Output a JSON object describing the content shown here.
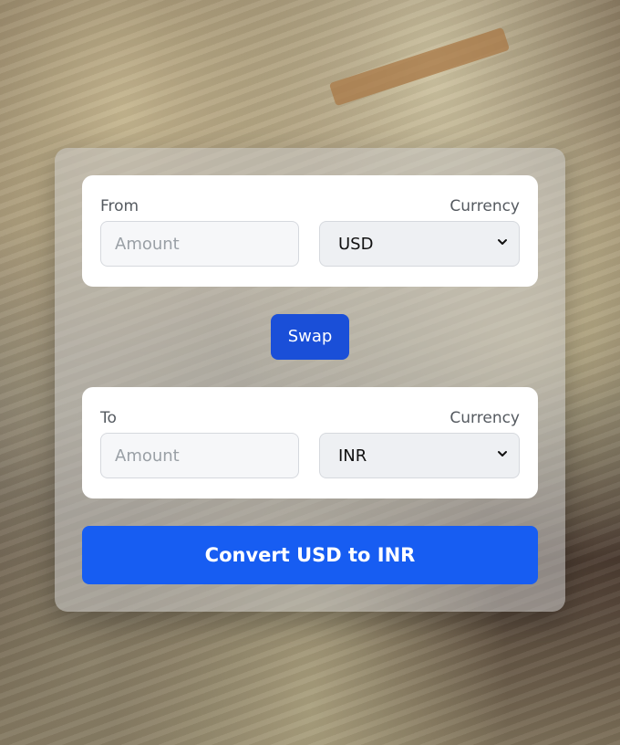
{
  "from": {
    "label": "From",
    "currency_label": "Currency",
    "amount_placeholder": "Amount",
    "currency_value": "USD"
  },
  "swap_label": "Swap",
  "to": {
    "label": "To",
    "currency_label": "Currency",
    "amount_placeholder": "Amount",
    "currency_value": "INR"
  },
  "convert_label": "Convert USD to INR",
  "colors": {
    "primary": "#175df2",
    "swap": "#1a4fd8",
    "card": "#ffffff"
  },
  "icons": [
    "chevron-down-icon"
  ]
}
